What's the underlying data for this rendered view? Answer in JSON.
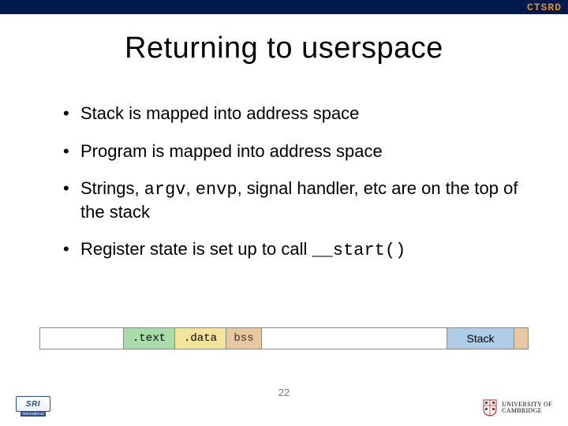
{
  "topbar": {
    "label": "CTSRD"
  },
  "title": "Returning to userspace",
  "bullets": [
    {
      "html": "Stack is mapped into address space"
    },
    {
      "html": "Program is mapped into address space"
    },
    {
      "html": "Strings, <span class=\"mono\">argv</span>, <span class=\"mono\">envp</span>, signal handler, etc are on the top of the stack"
    },
    {
      "html": "Register state is set up to call <span class=\"mono\">__start()</span>"
    }
  ],
  "memory": {
    "text": ".text",
    "data": ".data",
    "bss": "bss",
    "stack": "Stack"
  },
  "page": "22",
  "footer": {
    "sri": "SRI",
    "sri_sub": "International",
    "cambridge_line1": "UNIVERSITY OF",
    "cambridge_line2": "CAMBRIDGE"
  }
}
